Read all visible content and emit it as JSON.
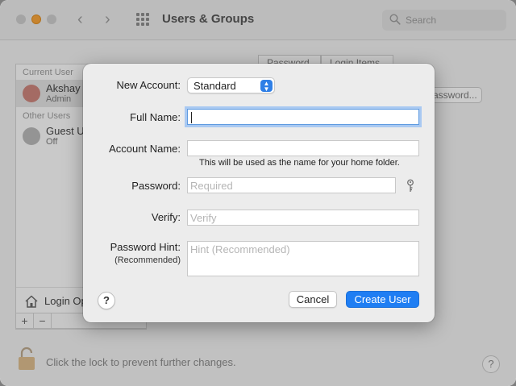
{
  "window": {
    "title": "Users & Groups",
    "search_placeholder": "Search"
  },
  "background": {
    "current_user_label": "Current User",
    "current_user_name": "Akshay",
    "current_user_role": "Admin",
    "other_users_label": "Other Users",
    "guest_name": "Guest U",
    "guest_status": "Off",
    "login_options_label": "Login Op",
    "tabs": [
      "Password",
      "Login Items"
    ],
    "change_password_btn": "assword...",
    "add_btn": "+",
    "remove_btn": "−",
    "lock_text": "Click the lock to prevent further changes.",
    "help_label": "?"
  },
  "sheet": {
    "new_account_label": "New Account:",
    "account_type": "Standard",
    "full_name_label": "Full Name:",
    "full_name_value": "",
    "account_name_label": "Account Name:",
    "account_name_value": "",
    "account_name_note": "This will be used as the name for your home folder.",
    "password_label": "Password:",
    "password_placeholder": "Required",
    "verify_label": "Verify:",
    "verify_placeholder": "Verify",
    "hint_label": "Password Hint:",
    "hint_sublabel": "(Recommended)",
    "hint_placeholder": "Hint (Recommended)",
    "help_label": "?",
    "cancel_label": "Cancel",
    "create_label": "Create User"
  },
  "colors": {
    "accent": "#1f7ef3",
    "focus_ring": "#a9c9f2"
  }
}
